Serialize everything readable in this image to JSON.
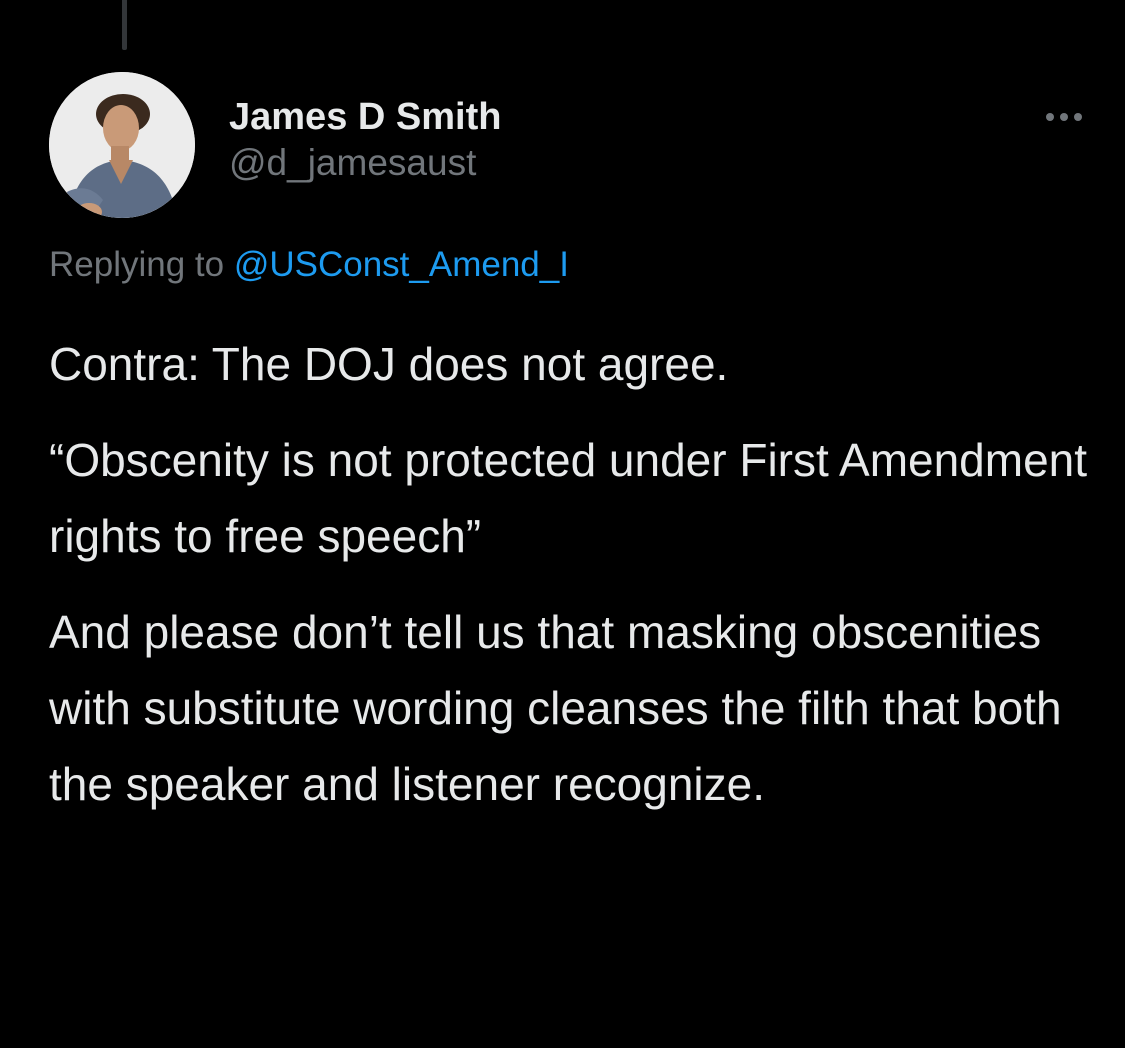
{
  "tweet": {
    "author": {
      "display_name": "James D Smith",
      "handle": "@d_jamesaust",
      "avatar_icon": "profile-photo"
    },
    "more_icon": "ellipsis-icon",
    "reply": {
      "prefix": "Replying to ",
      "target": "@USConst_Amend_I"
    },
    "paragraphs": [
      "Contra: The DOJ does not agree.",
      "“Obscenity is not protected under First Amendment rights to free speech”",
      "And please don’t tell us that masking obscenities with substitute wording cleanses the filth that both the speaker and listener recognize."
    ]
  },
  "colors": {
    "background": "#000000",
    "text": "#e7e9ea",
    "secondary": "#71767b",
    "link": "#1d9bf0",
    "thread_line": "#333639"
  }
}
